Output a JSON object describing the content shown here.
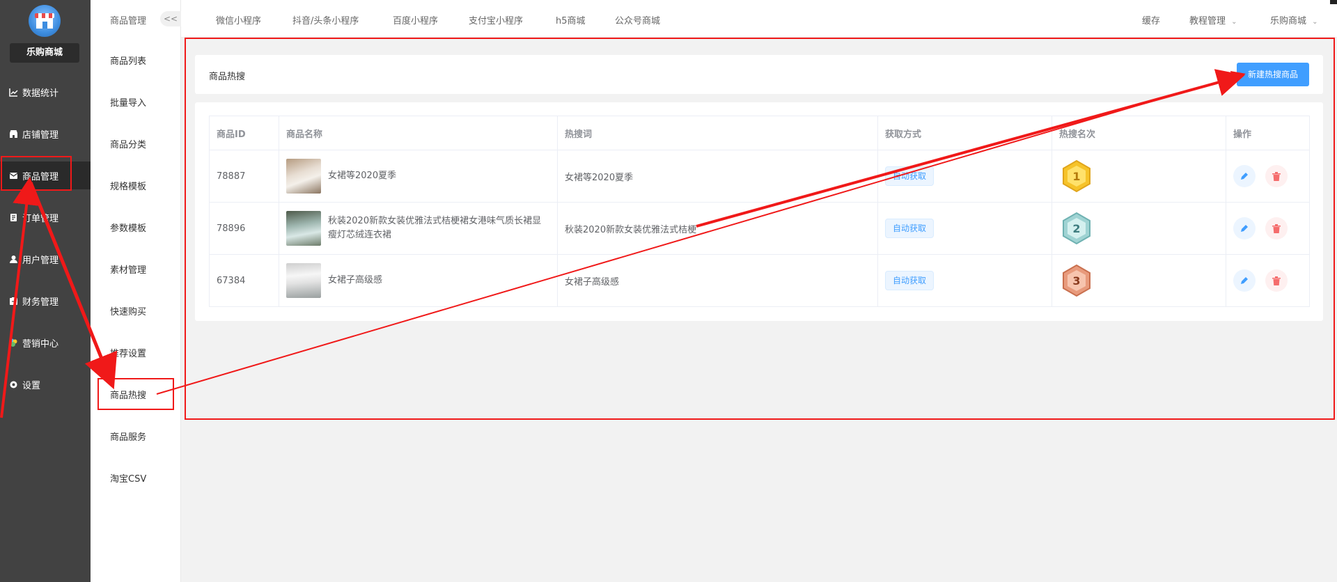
{
  "app": {
    "brand": "乐购商城"
  },
  "nav": {
    "items": [
      {
        "label": "数据统计",
        "icon": "chart-line-icon"
      },
      {
        "label": "店铺管理",
        "icon": "shop-icon"
      },
      {
        "label": "商品管理",
        "icon": "goods-box-icon"
      },
      {
        "label": "订单管理",
        "icon": "order-list-icon"
      },
      {
        "label": "用户管理",
        "icon": "user-icon"
      },
      {
        "label": "财务管理",
        "icon": "finance-icon"
      },
      {
        "label": "营销中心",
        "icon": "marketing-icon"
      },
      {
        "label": "设置",
        "icon": "gear-icon"
      }
    ]
  },
  "subnav": {
    "title": "商品管理",
    "collapse_label": "<<",
    "items": [
      "商品列表",
      "批量导入",
      "商品分类",
      "规格模板",
      "参数模板",
      "素材管理",
      "快速购买",
      "推荐设置",
      "商品热搜",
      "商品服务",
      "淘宝CSV"
    ]
  },
  "topbar": {
    "tabs": [
      "微信小程序",
      "抖音/头条小程序",
      "百度小程序",
      "支付宝小程序",
      "h5商城",
      "公众号商城"
    ],
    "right": {
      "cache": "缓存",
      "tutorial": "教程管理",
      "store": "乐购商城"
    }
  },
  "page": {
    "title": "商品热搜",
    "new_button": "新建热搜商品"
  },
  "table": {
    "headers": [
      "商品ID",
      "商品名称",
      "热搜词",
      "获取方式",
      "热搜名次",
      "操作"
    ],
    "rows": [
      {
        "id": "78887",
        "name": "女裙等2020夏季",
        "keyword": "女裙等2020夏季",
        "method": "自动获取",
        "rank": "1"
      },
      {
        "id": "78896",
        "name": "秋装2020新款女装优雅法式桔梗裙女港味气质长裙显瘦灯芯绒连衣裙",
        "keyword": "秋装2020新款女装优雅法式桔梗",
        "method": "自动获取",
        "rank": "2"
      },
      {
        "id": "67384",
        "name": "女裙子高级感",
        "keyword": "女裙子高级感",
        "method": "自动获取",
        "rank": "3"
      }
    ]
  },
  "colors": {
    "primary": "#409eff",
    "danger": "#f56c6c",
    "annotation": "#f01919",
    "sidebar": "#424242",
    "gold": "#f6c329",
    "silver": "#9fd3d3",
    "bronze": "#e89a7c"
  }
}
